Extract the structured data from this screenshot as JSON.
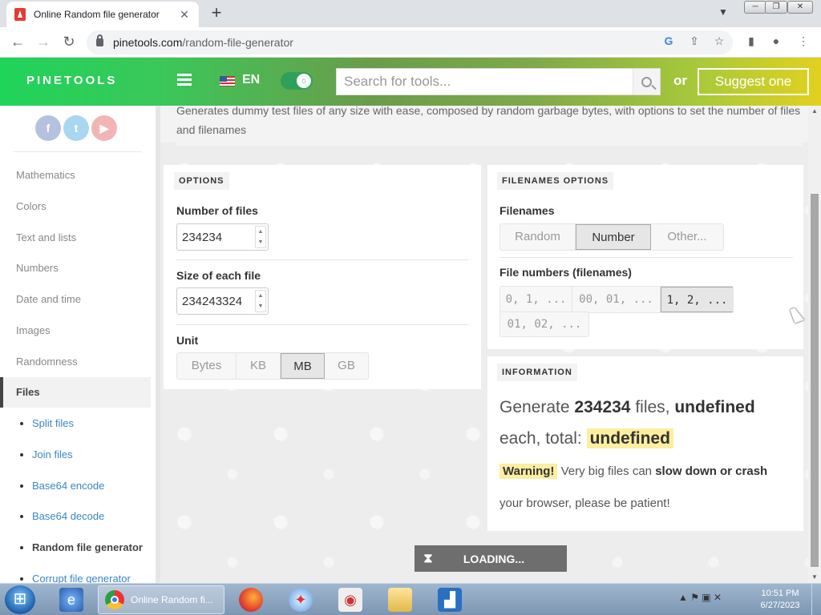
{
  "browser": {
    "tab_title": "Online Random file generator",
    "tab_close": "✕",
    "new_tab": "+",
    "url_domain": "pinetools.com",
    "url_path": "/random-file-generator",
    "min_label": "─",
    "max_label": "❐",
    "close_label": "✕"
  },
  "header": {
    "logo": "PINETOOLS",
    "language": "EN",
    "search_placeholder": "Search for tools...",
    "or_text": "or",
    "suggest_label": "Suggest one"
  },
  "sidebar": {
    "social": [
      "f",
      "t",
      "▶"
    ],
    "categories": [
      "Mathematics",
      "Colors",
      "Text and lists",
      "Numbers",
      "Date and time",
      "Images",
      "Randomness"
    ],
    "active_category": "Files",
    "subitems": [
      "Split files",
      "Join files",
      "Base64 encode",
      "Base64 decode",
      "Random file generator",
      "Corrupt file generator"
    ]
  },
  "main": {
    "description": "Generates dummy test files of any size with ease, composed by random garbage bytes, with options to set the number of files and filenames",
    "options": {
      "title": "OPTIONS",
      "num_files_label": "Number of files",
      "num_files_value": "234234",
      "size_label": "Size of each file",
      "size_value": "234243324",
      "unit_label": "Unit",
      "units": [
        "Bytes",
        "KB",
        "MB",
        "GB"
      ],
      "selected_unit": "MB"
    },
    "filenames": {
      "title": "FILENAMES OPTIONS",
      "filenames_label": "Filenames",
      "filename_modes": [
        "Random",
        "Number",
        "Other..."
      ],
      "selected_mode": "Number",
      "numbers_label": "File numbers (filenames)",
      "number_formats": [
        "0, 1, ...",
        "00, 01, ...",
        "1, 2, ...",
        "01, 02, ..."
      ],
      "selected_format": "1, 2, ..."
    },
    "information": {
      "title": "INFORMATION",
      "line1_prefix": "Generate",
      "files_count": "234234",
      "line1_mid": "files,",
      "size_each": "undefined",
      "line2_prefix": "each, total:",
      "total": "undefined",
      "warning_label": "Warning!",
      "warning_text_1": "Very big files can",
      "warning_bold": "slow down or crash",
      "warning_text_2": "your browser, please be patient!"
    },
    "loading": "LOADING..."
  },
  "taskbar": {
    "active_window": "Online Random fi...",
    "time": "10:51 PM",
    "date": "6/27/2023"
  },
  "colors": {
    "header_green": "#1fd45a",
    "header_yellow": "#e2d11f",
    "link_blue": "#3a86c8",
    "highlight": "#fdeea0"
  }
}
